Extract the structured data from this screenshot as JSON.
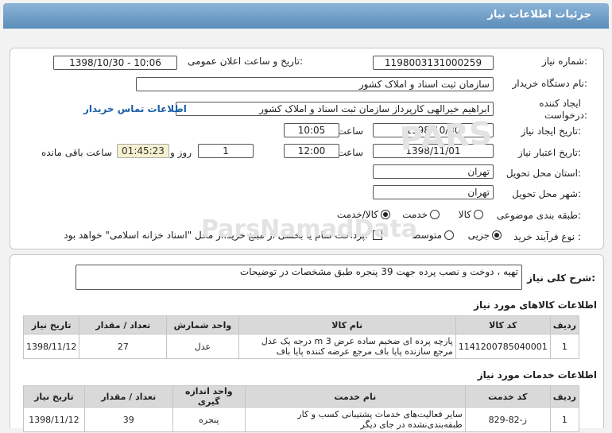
{
  "header": {
    "title": "جزئیات اطلاعات نیاز"
  },
  "form": {
    "need_number_label": "شماره نیاز:",
    "need_number": "1198003131000259",
    "announce_label": "تاریخ و ساعت اعلان عمومی:",
    "announce_value": "1398/10/30 - 10:06",
    "buyer_org_label": "نام دستگاه خریدار:",
    "buyer_org": "سازمان ثبت اسناد و املاک کشور",
    "creator_label_1": "ایجاد کننده",
    "creator_label_2": "درخواست:",
    "creator": "ابراهیم خیرالهی کارپرداز سازمان ثبت اسناد و املاک کشور",
    "buyer_contact_link": "اطلاعات تماس خریدار",
    "created_date_label": "تاریخ ایجاد نیاز:",
    "created_date": "1398/10/30",
    "time_label": "ساعت",
    "created_time": "10:05",
    "validity_label": "تاریخ اعتبار نیاز:",
    "validity_date": "1398/11/01",
    "validity_time": "12:00",
    "days": "1",
    "days_label": "روز و",
    "remaining_time": "01:45:23",
    "remaining_label": "ساعت باقی مانده",
    "province_label": "استان محل تحویل:",
    "province": "تهران",
    "city_label": "شهر محل تحویل:",
    "city": "تهران",
    "category_label": "طبقه بندی موضوعی:",
    "category_options": [
      "کالا",
      "خدمت",
      "کالا/خدمت"
    ],
    "process_label": "نوع فرآیند خرید :",
    "process_options": [
      "جزیی",
      "متوسط"
    ],
    "payment_note": "پرداخت تمام یا بخشی از مبلغ خرید،از محل \"اسناد خزانه اسلامی\" خواهد بود."
  },
  "description": {
    "label": "شرح کلی نیاز:",
    "text": "تهیه ، دوخت و نصب پرده جهت 39 پنجره طبق مشخصات در توضیحات"
  },
  "goods": {
    "title": "اطلاعات کالاهای مورد نیاز",
    "headers": [
      "ردیف",
      "کد کالا",
      "نام کالا",
      "واحد شمارش",
      "تعداد / مقدار",
      "تاریخ نیاز"
    ],
    "rows": [
      {
        "row": "1",
        "code": "1141200785040001",
        "name": "پارچه پرده ای ضخیم ساده عرض 3 m درجه یک عدل مرجع سازنده پایا باف مرجع عرضه کننده پایا باف",
        "unit": "عدل",
        "qty": "27",
        "date": "1398/11/12"
      }
    ]
  },
  "services": {
    "title": "اطلاعات خدمات مورد نیاز",
    "headers": [
      "ردیف",
      "کد خدمت",
      "نام خدمت",
      "واحد اندازه گیری",
      "تعداد / مقدار",
      "تاریخ نیاز"
    ],
    "rows": [
      {
        "row": "1",
        "code": "ز-82-829",
        "name": "سایر فعالیت‌های خدمات پشتیبانی کسب و کار طبقه‌بندی‌نشده در جای دیگر",
        "unit": "پنجره",
        "qty": "39",
        "date": "1398/11/12"
      }
    ]
  }
}
